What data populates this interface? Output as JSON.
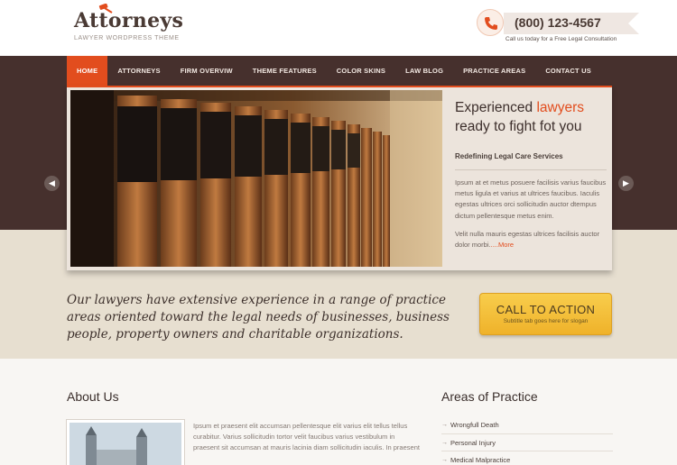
{
  "logo": {
    "title": "Attorneys",
    "subtitle": "LAWYER WORDPRESS THEME",
    "gavel_icon": "gavel-icon"
  },
  "contact": {
    "phone": "(800) 123-4567",
    "note": "Call us today for a Free Legal Consultation",
    "icon": "phone-icon"
  },
  "nav": [
    {
      "label": "HOME",
      "active": true
    },
    {
      "label": "ATTORNEYS"
    },
    {
      "label": "FIRM OVERVIW"
    },
    {
      "label": "THEME FEATURES"
    },
    {
      "label": "COLOR SKINS"
    },
    {
      "label": "LAW BLOG"
    },
    {
      "label": "PRACTICE AREAS"
    },
    {
      "label": "CONTACT US"
    }
  ],
  "slider": {
    "heading_part1": "Experienced ",
    "heading_accent": "lawyers",
    "heading_part2": "ready to fight fot you",
    "subheading": "Redefining Legal Care Services",
    "paragraph1": "Ipsum at et metus posuere facilisis varius faucibus metus ligula et varius at ultrices faucibus. Iaculis egestas ultrices orci sollicitudin auctor dtempus dictum pellentesque metus enim.",
    "paragraph2": "Velit nulla mauris egestas ultrices facilisis auctor dolor morbi.",
    "more_link": "....More",
    "prev_icon": "chevron-left-icon",
    "next_icon": "chevron-right-icon"
  },
  "cta": {
    "text": "Our lawyers have extensive experience in a range of practice areas oriented toward the legal needs of businesses, business people, property owners and charitable organizations.",
    "button_label": "CALL TO ACTION",
    "button_sub": "Subtitle tab goes here for slogan"
  },
  "about": {
    "heading": "About Us",
    "text": "Ipsum et praesent elit accumsan pellentesque elit varius elit tellus tellus curabitur. Varius sollicitudin tortor velit faucibus varius vestibulum in praesent sit accumsan at mauris lacinia diam sollicitudin iaculis. In praesent"
  },
  "areas": {
    "heading": "Areas of Practice",
    "items": [
      "Wrongfull Death",
      "Personal Injury",
      "Medical Malpractice"
    ]
  },
  "colors": {
    "accent": "#e24d1e",
    "dark": "#46302d",
    "button": "#f4c13c"
  }
}
